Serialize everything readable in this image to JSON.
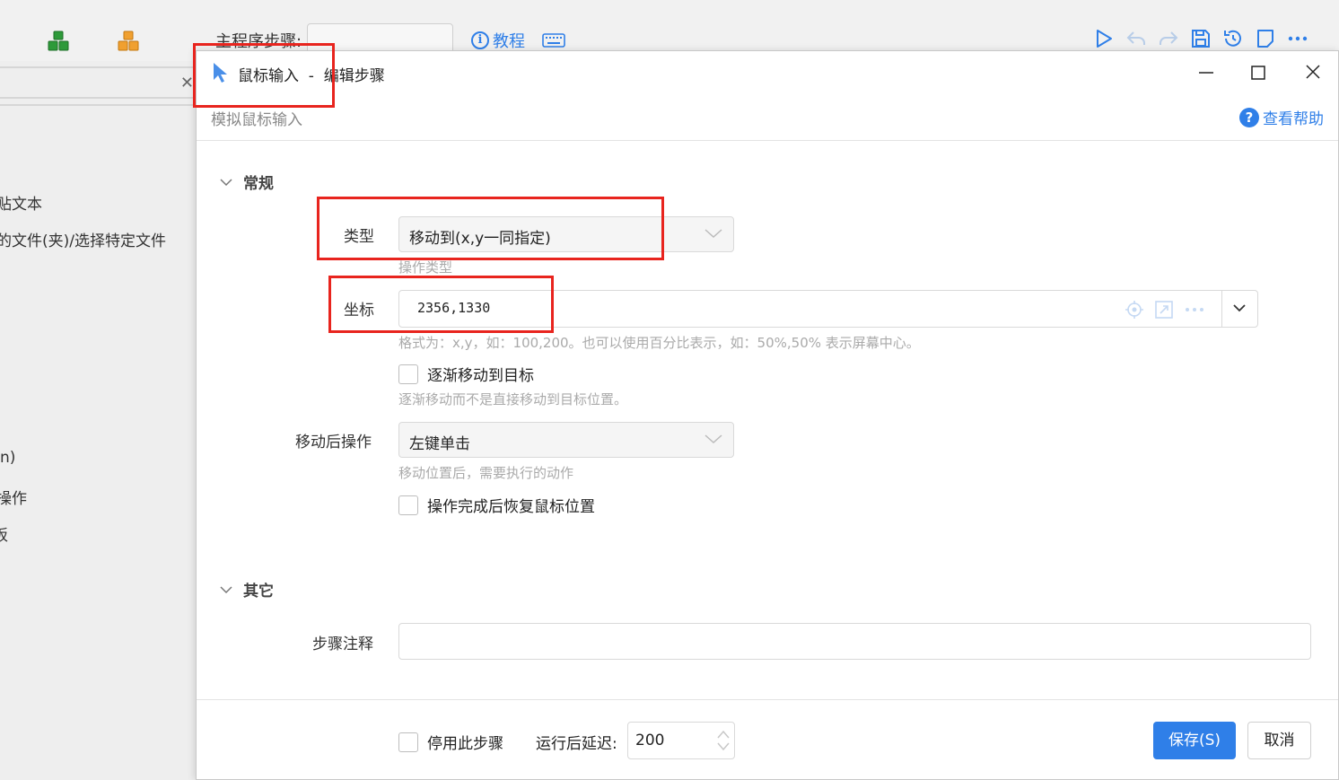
{
  "background_app": {
    "main_steps_label": "主程序步骤:",
    "tutorial_label": "教程",
    "sidebar_items": [
      "贴文本",
      "的文件(夹)/选择特定文件",
      "n)",
      "操作",
      "板"
    ]
  },
  "dialog": {
    "title": "鼠标输入  -  编辑步骤",
    "subtitle": "模拟鼠标输入",
    "help_label": "查看帮助",
    "window_controls": [
      "minimize-icon",
      "maximize-icon",
      "close-icon"
    ],
    "sections": {
      "general": "常规",
      "other": "其它"
    },
    "type_field": {
      "label": "类型",
      "value": "移动到(x,y一同指定)",
      "hint": "操作类型"
    },
    "coord_field": {
      "label": "坐标",
      "value": "2356,1330",
      "hint": "格式为：x,y，如：100,200。也可以使用百分比表示，如：50%,50% 表示屏幕中心。"
    },
    "gradual_move": {
      "label": "逐渐移动到目标",
      "checked": false,
      "hint": "逐渐移动而不是直接移动到目标位置。"
    },
    "after_move_field": {
      "label": "移动后操作",
      "value": "左键单击",
      "hint": "移动位置后，需要执行的动作"
    },
    "restore_position": {
      "label": "操作完成后恢复鼠标位置",
      "checked": false
    },
    "comment_field": {
      "label": "步骤注释",
      "value": ""
    },
    "footer": {
      "disable_step_label": "停用此步骤",
      "disable_step_checked": false,
      "delay_label": "运行后延迟:",
      "delay_value": "200",
      "save_label": "保存(S)",
      "cancel_label": "取消"
    }
  },
  "colors": {
    "accent": "#2f7fe8",
    "annotation": "#e8241e",
    "hint_text": "#aaaaaa"
  }
}
